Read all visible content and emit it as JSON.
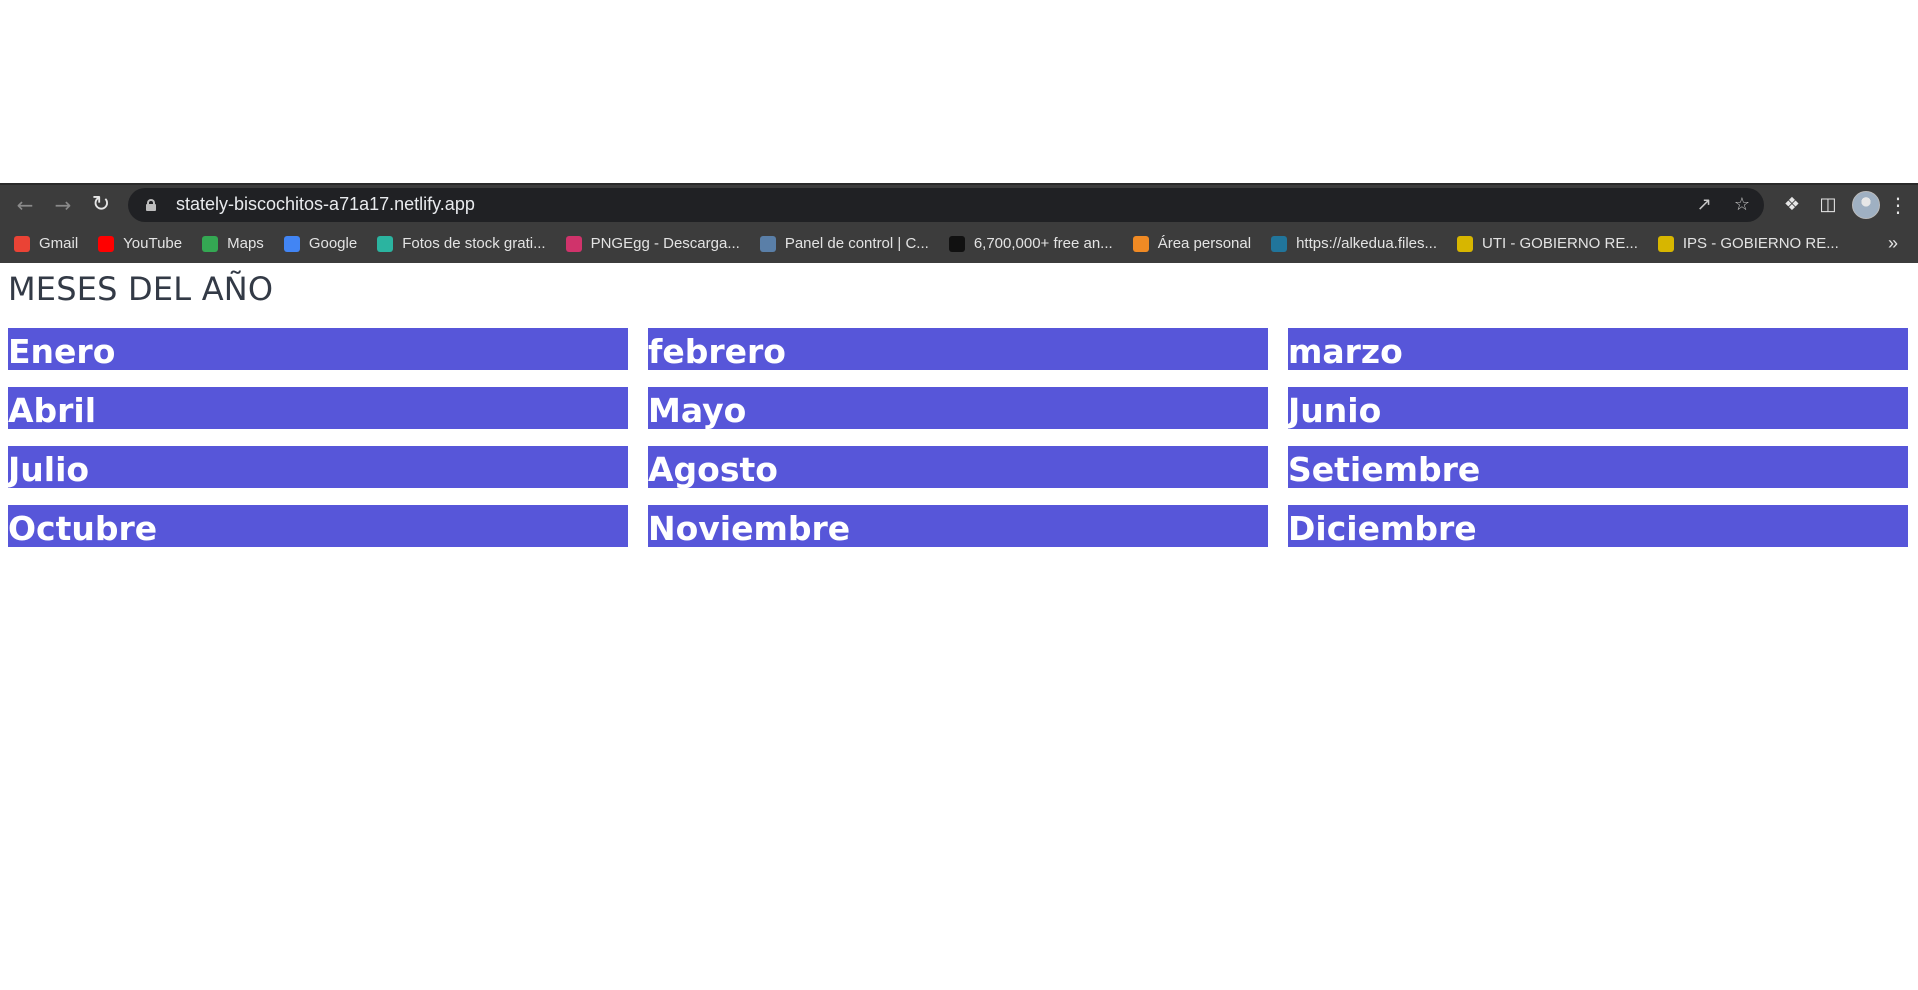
{
  "browser": {
    "url": "stately-biscochitos-a71a17.netlify.app",
    "bookmarks": [
      {
        "label": "Gmail",
        "icon": "gmail-icon",
        "color": "#ea4335"
      },
      {
        "label": "YouTube",
        "icon": "youtube-icon",
        "color": "#ff0000"
      },
      {
        "label": "Maps",
        "icon": "maps-icon",
        "color": "#34a853"
      },
      {
        "label": "Google",
        "icon": "google-icon",
        "color": "#4285f4"
      },
      {
        "label": "Fotos de stock grati...",
        "icon": "stock-photos-icon",
        "color": "#2bb4a0"
      },
      {
        "label": "PNGEgg - Descarga...",
        "icon": "pngegg-icon",
        "color": "#d0336b"
      },
      {
        "label": "Panel de control | C...",
        "icon": "panel-icon",
        "color": "#5a7fa8"
      },
      {
        "label": "6,700,000+ free an...",
        "icon": "free-icon",
        "color": "#111111"
      },
      {
        "label": "Área personal",
        "icon": "area-personal-icon",
        "color": "#f08a24"
      },
      {
        "label": "https://alkedua.files...",
        "icon": "wordpress-icon",
        "color": "#21759b"
      },
      {
        "label": "UTI - GOBIERNO RE...",
        "icon": "gobierno-icon",
        "color": "#d7b600"
      },
      {
        "label": "IPS - GOBIERNO RE...",
        "icon": "gobierno-icon-2",
        "color": "#d7b600"
      }
    ],
    "overflow": "»"
  },
  "page": {
    "title": "MESES DEL AÑO",
    "accent": "#5756d9",
    "months": [
      "Enero",
      "febrero",
      "marzo",
      "Abril",
      "Mayo",
      "Junio",
      "Julio",
      "Agosto",
      "Setiembre",
      "Octubre",
      "Noviembre",
      "Diciembre"
    ]
  }
}
